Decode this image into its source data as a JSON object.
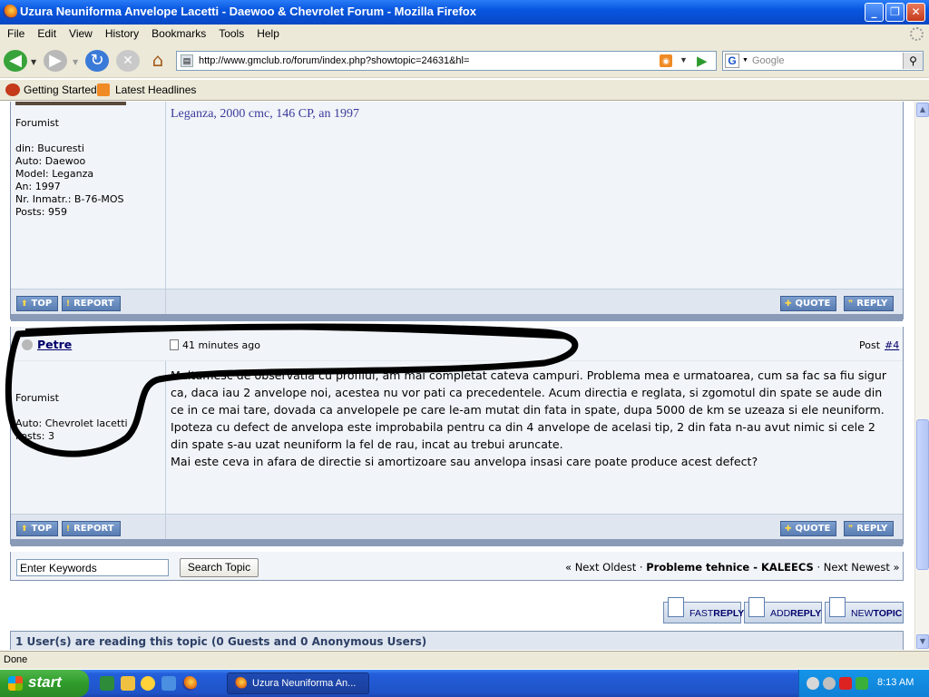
{
  "window": {
    "title": "Uzura Neuniforma Anvelope Lacetti - Daewoo & Chevrolet Forum - Mozilla Firefox"
  },
  "menu": [
    "File",
    "Edit",
    "View",
    "History",
    "Bookmarks",
    "Tools",
    "Help"
  ],
  "nav": {
    "url": "http://www.gmclub.ro/forum/index.php?showtopic=24631&hl=",
    "search_placeholder": "Google"
  },
  "bookmarks": [
    "Getting Started",
    "Latest Headlines"
  ],
  "post_prev": {
    "member_group": "Forumist",
    "profile": [
      "din: Bucuresti",
      "Auto: Daewoo",
      "Model: Leganza",
      "An: 1997",
      "Nr. Inmatr.: B-76-MOS",
      "Posts: 959"
    ],
    "signature": "Leganza, 2000 cmc, 146 CP, an 1997"
  },
  "post_buttons": {
    "top": "TOP",
    "report": "REPORT",
    "quote": "QUOTE",
    "reply": "REPLY"
  },
  "post4": {
    "author": "Petre",
    "time": "41 minutes ago",
    "post_label": "Post",
    "post_num": "#4",
    "member_group": "Forumist",
    "profile": [
      "Auto: Chevrolet lacetti",
      "Posts: 3"
    ],
    "body": [
      "Multumesc de observatia cu profilul, am mai completat cateva campuri. Problema mea e urmatoarea, cum sa fac sa fiu sigur ca, daca iau 2 anvelope noi, acestea nu vor pati ca precedentele. Acum directia e reglata, si zgomotul din spate se aude din ce in ce mai tare, dovada ca anvelopele pe care le-am mutat din fata in spate, dupa 5000 de km se uzeaza si ele neuniform.",
      "Ipoteza cu defect de anvelopa este improbabila pentru ca din 4 anvelope de acelasi tip, 2 din fata n-au avut nimic si cele 2 din spate s-au uzat neuniform la fel de rau, incat au trebui aruncate.",
      "Mai este ceva in afara de directie si amortizoare sau anvelopa insasi care poate produce acest defect?"
    ]
  },
  "topic_nav": {
    "keywords_value": "Enter Keywords",
    "search_button": "Search Topic",
    "next_oldest": "« Next Oldest",
    "sep": "·",
    "forum_name": "Probleme tehnice - KALEECS",
    "next_newest": "Next Newest »"
  },
  "action_buttons": {
    "fast_prefix": "FAST",
    "fast_suffix": "REPLY",
    "add_prefix": "ADD",
    "add_suffix": "REPLY",
    "new_prefix": "NEW",
    "new_suffix": "TOPIC"
  },
  "readers": "1 User(s) are reading this topic (0 Guests and 0 Anonymous Users)",
  "status": "Done",
  "taskbar": {
    "start": "start",
    "window_item": "Uzura Neuniforma An...",
    "clock": "8:13 AM"
  },
  "colors": {
    "link": "#00006b",
    "signature": "#3b3b9b",
    "accent": "#5a7db2"
  }
}
